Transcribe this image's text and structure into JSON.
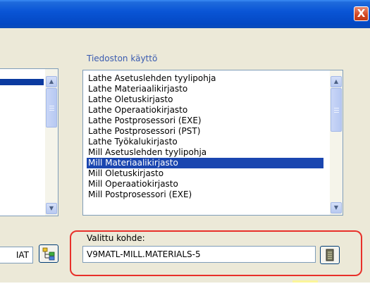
{
  "window": {
    "close_label": "X"
  },
  "left_panel": {
    "field_value": "IAT"
  },
  "file_usage": {
    "caption": "Tiedoston käyttö",
    "items": [
      "Lathe Asetuslehden tyylipohja",
      "Lathe Materiaalikirjasto",
      "Lathe Oletuskirjasto",
      "Lathe Operaatiokirjasto",
      "Lathe Postprosessori (EXE)",
      "Lathe Postprosessori (PST)",
      "Lathe Työkalukirjasto",
      "Mill Asetuslehden tyylipohja",
      "Mill Materiaalikirjasto",
      "Mill Oletuskirjasto",
      "Mill Operaatiokirjasto",
      "Mill Postprosessori (EXE)"
    ],
    "selected_item": "Mill Materiaalikirjasto"
  },
  "selected_target": {
    "caption": "Valittu kohde:",
    "value": "V9MATL-MILL.MATERIALS-5"
  },
  "colors": {
    "highlight_border": "#e8302a",
    "selection": "#1a46b0",
    "title_bar": "#0a55d6"
  },
  "icons": {
    "close": "close-icon",
    "browse": "document-browse-icon",
    "tree": "tree-structure-icon"
  }
}
